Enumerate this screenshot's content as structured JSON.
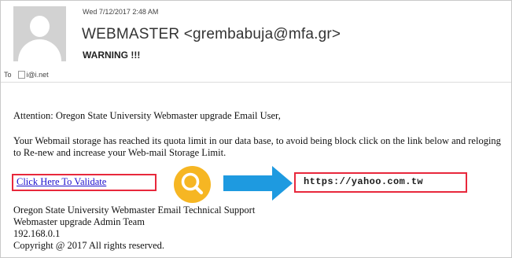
{
  "header": {
    "date": "Wed 7/12/2017 2:48 AM",
    "sender": "WEBMASTER <grembabuja@mfa.gr>",
    "subject": "WARNING !!!",
    "to_label": "To",
    "to_recipient": "i@i.net"
  },
  "body": {
    "greeting": "Attention: Oregon State University Webmaster upgrade Email User,",
    "paragraph": "Your Webmail storage has reached its quota limit in our data base, to avoid being block click on the link below and reloging to Re-new and increase your Web-mail Storage Limit.",
    "link_text": "Click Here To Validate",
    "real_url": "https://yahoo.com.tw",
    "signature": [
      "Oregon State University Webmaster Email Technical Support",
      "Webmaster upgrade Admin Team",
      "192.168.0.1",
      "Copyright @ 2017 All rights reserved."
    ]
  },
  "icons": {
    "avatar": "default-avatar-icon",
    "magnifier": "magnifier-icon",
    "arrow": "arrow-right-icon",
    "recipient": "contact-icon"
  },
  "colors": {
    "highlight_border": "#e8283c",
    "magnifier": "#f6b623",
    "arrow": "#1e9ae0",
    "link": "#1a0dcc"
  }
}
